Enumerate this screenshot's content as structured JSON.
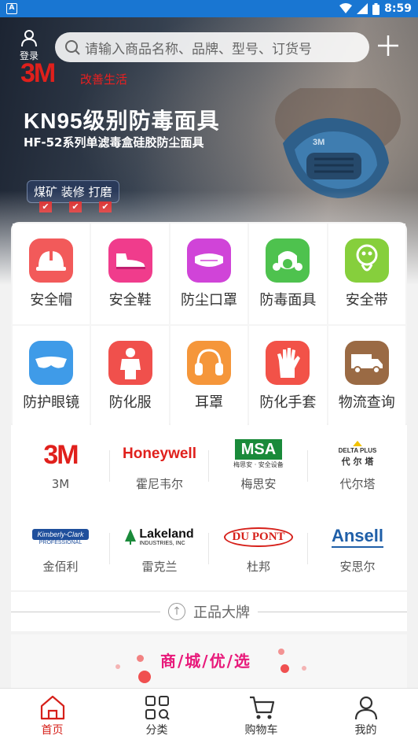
{
  "status_bar": {
    "time": "8:59"
  },
  "top_bar": {
    "login_label": "登录",
    "search_placeholder": "请输入商品名称、品牌、型号、订货号"
  },
  "banner": {
    "brand_logo": "3M",
    "slogan": "改善生活",
    "headline": "KN95级别防毒面具",
    "subline": "HF-52系列单滤毒盒硅胶防尘面具",
    "tag": "煤矿 装修 打磨",
    "checkmarks": [
      "✔",
      "✔",
      "✔"
    ],
    "mask_label": "3M"
  },
  "categories": [
    {
      "label": "安全帽",
      "icon": "helmet-icon",
      "color": "#f25a5a"
    },
    {
      "label": "安全鞋",
      "icon": "shoe-icon",
      "color": "#f03c8c"
    },
    {
      "label": "防尘口罩",
      "icon": "dust-mask-icon",
      "color": "#d044d8"
    },
    {
      "label": "防毒面具",
      "icon": "gas-mask-icon",
      "color": "#4ec24e"
    },
    {
      "label": "安全带",
      "icon": "harness-icon",
      "color": "#86cf3c"
    },
    {
      "label": "防护眼镜",
      "icon": "goggles-icon",
      "color": "#3f9be8"
    },
    {
      "label": "防化服",
      "icon": "hazmat-suit-icon",
      "color": "#f0504c"
    },
    {
      "label": "耳罩",
      "icon": "earmuff-icon",
      "color": "#f5963a"
    },
    {
      "label": "防化手套",
      "icon": "glove-icon",
      "color": "#f25248"
    },
    {
      "label": "物流查询",
      "icon": "truck-icon",
      "color": "#9a6a44"
    }
  ],
  "brands": [
    {
      "name": "3M",
      "logo_text": "3M",
      "logo_color": "#e0201c"
    },
    {
      "name": "霍尼韦尔",
      "logo_text": "Honeywell",
      "logo_color": "#e0201c"
    },
    {
      "name": "梅思安",
      "logo_text": "MSA",
      "logo_sub": "梅思安 · 安全设备",
      "logo_color": "#1a8a3a"
    },
    {
      "name": "代尔塔",
      "logo_text": "DELTA PLUS",
      "logo_sub": "代 尔 塔",
      "logo_color": "#333333"
    },
    {
      "name": "金佰利",
      "logo_text": "Kimberly-Clark",
      "logo_sub": "PROFESSIONAL",
      "logo_color": "#1f4f9c"
    },
    {
      "name": "雷克兰",
      "logo_text": "Lakeland",
      "logo_sub": "INDUSTRIES, INC",
      "logo_color": "#111111"
    },
    {
      "name": "杜邦",
      "logo_text": "DU PONT",
      "logo_color": "#d6201a"
    },
    {
      "name": "安思尔",
      "logo_text": "Ansell",
      "logo_color": "#1f5fa8"
    }
  ],
  "section_divider": {
    "label": "正品大牌"
  },
  "featured": {
    "title": "商/城/优/选"
  },
  "bottom_nav": [
    {
      "label": "首页",
      "icon": "home-icon",
      "active": true
    },
    {
      "label": "分类",
      "icon": "category-grid-icon",
      "active": false
    },
    {
      "label": "购物车",
      "icon": "cart-icon",
      "active": false
    },
    {
      "label": "我的",
      "icon": "profile-icon",
      "active": false
    }
  ],
  "colors": {
    "status_bar": "#1976d2",
    "accent": "#d6201a",
    "featured_title": "#e8197a"
  }
}
